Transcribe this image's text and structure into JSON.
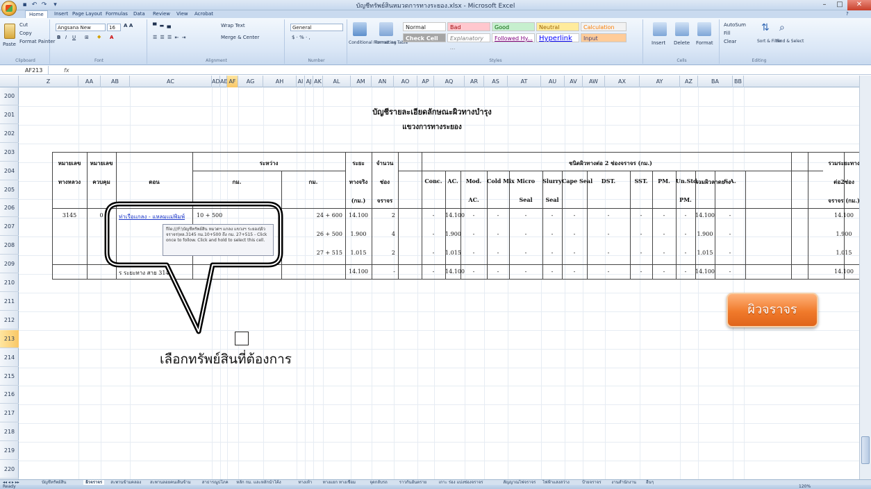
{
  "window": {
    "title": "บัญชีทรัพย์สินหมวดการทางระยอง.xlsx - Microsoft Excel",
    "min": "–",
    "max": "□",
    "close": "✕"
  },
  "ribbon_tabs": [
    "Home",
    "Insert",
    "Page Layout",
    "Formulas",
    "Data",
    "Review",
    "View",
    "Acrobat"
  ],
  "ribbon": {
    "clipboard": {
      "paste": "Paste",
      "cut": "Cut",
      "copy": "Copy",
      "format_painter": "Format Painter",
      "label": "Clipboard"
    },
    "font": {
      "name": "Angsana New",
      "size": "16",
      "label": "Font"
    },
    "alignment": {
      "wrap": "Wrap Text",
      "merge": "Merge & Center",
      "label": "Alignment"
    },
    "number": {
      "format": "General",
      "label": "Number"
    },
    "styles": {
      "conditional": "Conditional Formatting",
      "format_table": "Format as Table",
      "normal": "Normal",
      "bad": "Bad",
      "good": "Good",
      "neutral": "Neutral",
      "calculation": "Calculation",
      "check_cell": "Check Cell",
      "explanatory": "Explanatory ...",
      "followed": "Followed Hy...",
      "hyperlink": "Hyperlink",
      "input": "Input",
      "label": "Styles"
    },
    "cells": {
      "insert": "Insert",
      "delete": "Delete",
      "format": "Format",
      "label": "Cells"
    },
    "editing": {
      "autosum": "AutoSum",
      "fill": "Fill",
      "clear": "Clear",
      "sort": "Sort & Filter",
      "find": "Find & Select",
      "label": "Editing"
    }
  },
  "formula_bar": {
    "name_box": "AF213",
    "fx": "fx",
    "value": ""
  },
  "columns": [
    "Z",
    "AA",
    "AB",
    "AC",
    "AD",
    "AE",
    "AF",
    "AG",
    "AH",
    "AI",
    "AJ",
    "AK",
    "AL",
    "AM",
    "AN",
    "AO",
    "AP",
    "AQ",
    "AR",
    "AS",
    "AT",
    "AU",
    "AV",
    "AW",
    "AX",
    "AY",
    "AZ",
    "BA",
    "BB"
  ],
  "selected_column": "AF",
  "rows": [
    "200",
    "201",
    "202",
    "203",
    "204",
    "205",
    "206",
    "207",
    "208",
    "209",
    "210",
    "211",
    "212",
    "213",
    "214",
    "215",
    "216",
    "217",
    "218",
    "219",
    "220"
  ],
  "selected_row": "213",
  "sheet": {
    "title": "บัญชีรายละเอียดลักษณะผิวทางบำรุง",
    "subtitle": "แขวงการทางระยอง",
    "headers": {
      "road_no_1": "หมายเลข",
      "road_no_2": "ทางหลวง",
      "ctrl_no_1": "หมายเลข",
      "ctrl_no_2": "ควบคุม",
      "section": "ตอน",
      "between": "ระหว่าง",
      "km_from": "กม.",
      "km_to": "กม.",
      "dist_1": "ระยะ",
      "dist_2": "ทางจริง",
      "dist_3": "(กม.)",
      "lanes_1": "จำนวน",
      "lanes_2": "ช่อง",
      "lanes_3": "จราจร",
      "surface_group": "ชนิดผิวทางต่อ 2 ช่องจราจร (กม.)",
      "conc": "Conc.",
      "ac": "AC.",
      "mod_ac_1": "Mod.",
      "mod_ac_2": "AC.",
      "cold_mix": "Cold Mix",
      "micro_1": "Micro",
      "micro_2": "Seal",
      "slurry_1": "Slurry",
      "slurry_2": "Seal",
      "cape_seal": "Cape Seal",
      "dst": "DST.",
      "sst": "SST.",
      "pm": "PM.",
      "unstd_1": "Un.Std.,",
      "unstd_2": "PM.",
      "paved_total": "รวมผิวลาดยาง",
      "sa": "S.A.",
      "total_1": "รวมระยะทาง",
      "total_2": "ต่อ2ช่อง",
      "total_3": "จราจร (กม.)",
      "note": "หมาย"
    },
    "rows": [
      {
        "road": "3145",
        "ctrl": "0",
        "section": "ท่าเรือแกลง - แหลมแม่พิมพ์",
        "km_from": "10 + 500",
        "km_to": "24 + 600",
        "dist": "14.100",
        "lanes": "2",
        "conc": "-",
        "ac": "14.100",
        "mod": "-",
        "cold": "-",
        "micro": "-",
        "slurry": "-",
        "cape": "-",
        "dst": "-",
        "sst": "-",
        "pm": "-",
        "unstd": "-",
        "paved": "14.100",
        "sa": "-",
        "total": "14.100"
      },
      {
        "road": "",
        "ctrl": "",
        "section": "",
        "km_from": "",
        "km_to": "26 + 500",
        "dist": "1.900",
        "lanes": "4",
        "conc": "-",
        "ac": "1.900",
        "mod": "-",
        "cold": "-",
        "micro": "-",
        "slurry": "-",
        "cape": "-",
        "dst": "-",
        "sst": "-",
        "pm": "-",
        "unstd": "-",
        "paved": "1.900",
        "sa": "-",
        "total": "1.900"
      },
      {
        "road": "",
        "ctrl": "",
        "section": "",
        "km_from": "",
        "km_to": "27 + 515",
        "dist": "1.015",
        "lanes": "2",
        "conc": "-",
        "ac": "1.015",
        "mod": "-",
        "cold": "-",
        "micro": "-",
        "slurry": "-",
        "cape": "-",
        "dst": "-",
        "sst": "-",
        "pm": "-",
        "unstd": "-",
        "paved": "1.015",
        "sa": "-",
        "total": "1.015"
      },
      {
        "road": "",
        "ctrl": "",
        "section": "ร ระยะทาง สาย 3145",
        "km_from": "",
        "km_to": "",
        "dist": "14.100",
        "lanes": "-",
        "conc": "-",
        "ac": "14.100",
        "mod": "-",
        "cold": "-",
        "micro": "-",
        "slurry": "-",
        "cape": "-",
        "dst": "-",
        "sst": "-",
        "pm": "-",
        "unstd": "-",
        "paved": "14.100",
        "sa": "-",
        "total": "14.100"
      }
    ],
    "tooltip": "file:///F:\\บัญชีทรัพย์สิน หมวดฯ แกลง แขวงฯ ระยอง\\ผิวจราจร\\ทล.3145 กม.10+500 ถึง กม. 27+515 - Click once to follow. Click and hold to select this cell.",
    "callout_text": "เลือกทรัพย์สินที่ต้องการ",
    "road_button": "ผิวจราจร"
  },
  "sheet_tabs": [
    "บัญชีทรัพย์สิน",
    "ผิวจราจร",
    "สะพานข้ามคลอง",
    "สะพานลอยคนเดินข้าม",
    "สาธารณูปโภค",
    "หลัก กม. และหลักนำโค้ง",
    "ทางเท้า",
    "ทางแยก ทางเชื่อม",
    "จุดกลับรถ",
    "ราวกันอันตราย",
    "เกาะ ร่อง แบ่งช่องจราจร",
    "สัญญาณไฟจราจร",
    "ไฟฟ้าแสงสว่าง",
    "ป้ายจราจร",
    "งานสำนักงาน",
    "อื่นๆ"
  ],
  "active_sheet": "ผิวจราจร",
  "status": {
    "ready": "Ready",
    "zoom": "120%"
  }
}
